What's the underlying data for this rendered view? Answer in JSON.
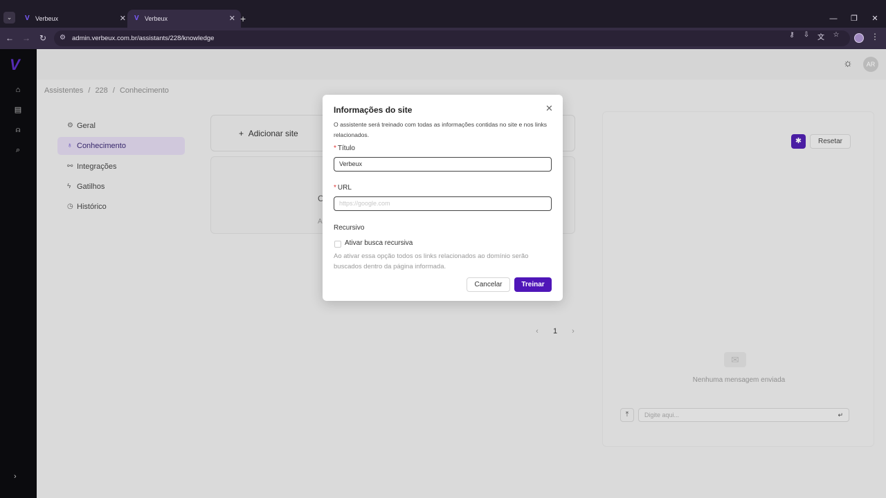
{
  "browser": {
    "tabs": [
      {
        "title": "Verbeux",
        "active": false
      },
      {
        "title": "Verbeux",
        "active": true
      }
    ],
    "url": "admin.verbeux.com.br/assistants/228/knowledge"
  },
  "header": {
    "avatar_initials": "AR"
  },
  "breadcrumb": [
    "Assistentes",
    "/",
    "228",
    "/",
    "Conhecimento"
  ],
  "submenu": [
    {
      "label": "Geral",
      "icon": "gear-icon",
      "active": false
    },
    {
      "label": "Conhecimento",
      "icon": "lightbulb-icon",
      "active": true
    },
    {
      "label": "Integrações",
      "icon": "link-icon",
      "active": false
    },
    {
      "label": "Gatilhos",
      "icon": "bolt-icon",
      "active": false
    },
    {
      "label": "Histórico",
      "icon": "history-icon",
      "active": false
    }
  ],
  "knowledge": {
    "add_site_label": "Adicionar site",
    "empty_title_fragment": "C",
    "empty_sub_fragment": "A"
  },
  "pagination": {
    "current": "1"
  },
  "chat": {
    "reset_label": "Resetar",
    "empty_message": "Nenhuma mensagem enviada",
    "input_placeholder": "Digite aqui..."
  },
  "modal": {
    "title": "Informações do site",
    "description": "O assistente será treinado com todas as informações contidas no site e nos links relacionados.",
    "title_label": "Título",
    "title_value": "Verbeux",
    "url_label": "URL",
    "url_placeholder": "https://google.com",
    "recursive_heading": "Recursivo",
    "recursive_checkbox_label": "Ativar busca recursiva",
    "recursive_checked": false,
    "recursive_help": "Ao ativar essa opção todos os links relacionados ao domínio serão buscados dentro da página informada.",
    "cancel_label": "Cancelar",
    "train_label": "Treinar"
  },
  "colors": {
    "brand_purple": "#4f16b8",
    "active_menu_bg": "#ddd5ea"
  }
}
